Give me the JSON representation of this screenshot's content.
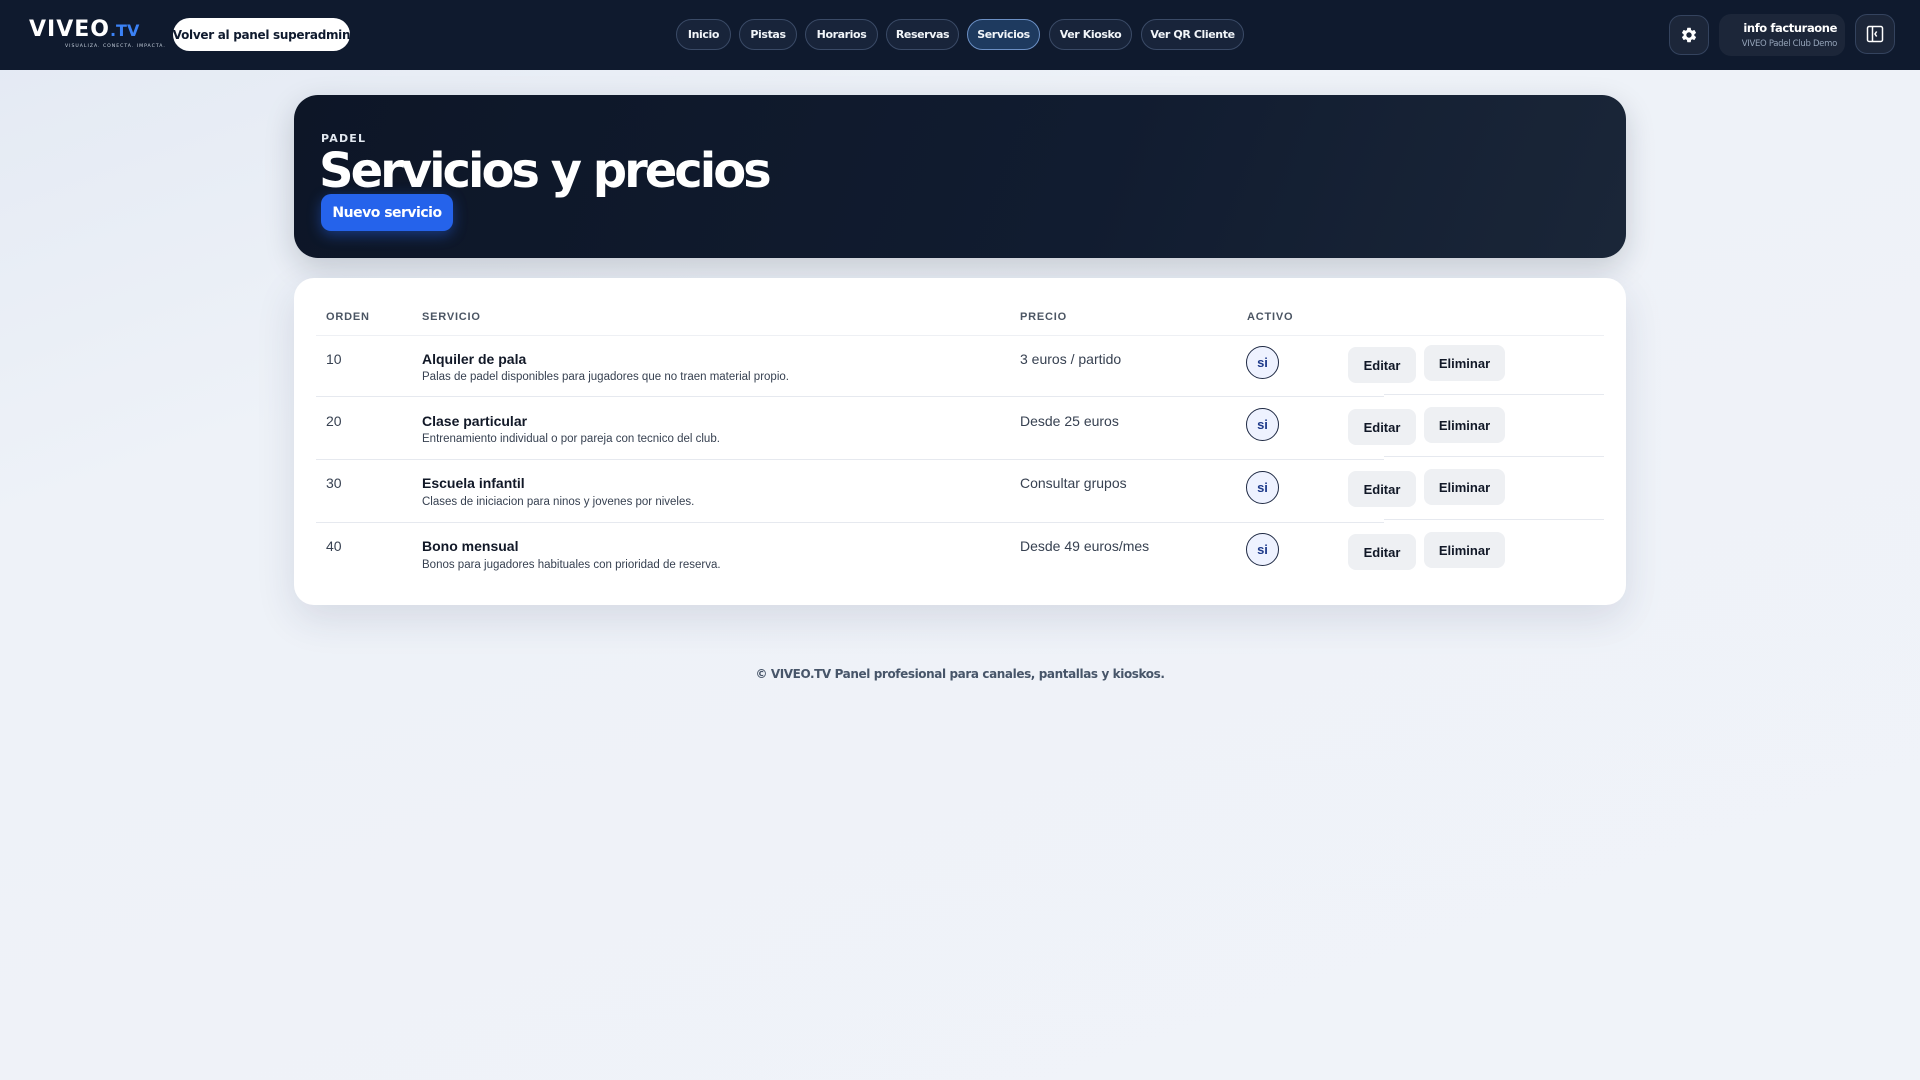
{
  "header": {
    "logo_text": "VIVEO",
    "logo_suffix": ".TV",
    "logo_tagline": "VISUALIZA. CONECTA. IMPACTA.",
    "back_button": "Volver al panel superadmin",
    "nav": [
      {
        "label": "Inicio",
        "active": false
      },
      {
        "label": "Pistas",
        "active": false
      },
      {
        "label": "Horarios",
        "active": false
      },
      {
        "label": "Reservas",
        "active": false
      },
      {
        "label": "Servicios",
        "active": true
      },
      {
        "label": "Ver Kiosko",
        "active": false
      },
      {
        "label": "Ver QR Cliente",
        "active": false
      }
    ],
    "settings_icon": "gear-icon",
    "user": {
      "name": "info facturaone",
      "org": "VIVEO Padel Club Demo"
    },
    "panel_icon": "panel-toggle-icon"
  },
  "hero": {
    "eyebrow": "PADEL",
    "title": "Servicios y precios",
    "new_button": "Nuevo servicio"
  },
  "table": {
    "columns": [
      "ORDEN",
      "SERVICIO",
      "PRECIO",
      "ACTIVO"
    ],
    "rows": [
      {
        "orden": "10",
        "name": "Alquiler de pala",
        "description": "Palas de padel disponibles para jugadores que no traen material propio.",
        "price": "3 euros / partido",
        "active": "si",
        "edit": "Editar",
        "delete": "Eliminar"
      },
      {
        "orden": "20",
        "name": "Clase particular",
        "description": "Entrenamiento individual o por pareja con tecnico del club.",
        "price": "Desde 25 euros",
        "active": "si",
        "edit": "Editar",
        "delete": "Eliminar"
      },
      {
        "orden": "30",
        "name": "Escuela infantil",
        "description": "Clases de iniciacion para ninos y jovenes por niveles.",
        "price": "Consultar grupos",
        "active": "si",
        "edit": "Editar",
        "delete": "Eliminar"
      },
      {
        "orden": "40",
        "name": "Bono mensual",
        "description": "Bonos para jugadores habituales con prioridad de reserva.",
        "price": "Desde 49 euros/mes",
        "active": "si",
        "edit": "Editar",
        "delete": "Eliminar"
      }
    ]
  },
  "footer": "© VIVEO.TV Panel profesional para canales, pantallas y kioskos.",
  "colors": {
    "topbar": "#0f1a2e",
    "accent": "#2563eb",
    "hero": "#0d1627",
    "background": "#eef2f8"
  }
}
